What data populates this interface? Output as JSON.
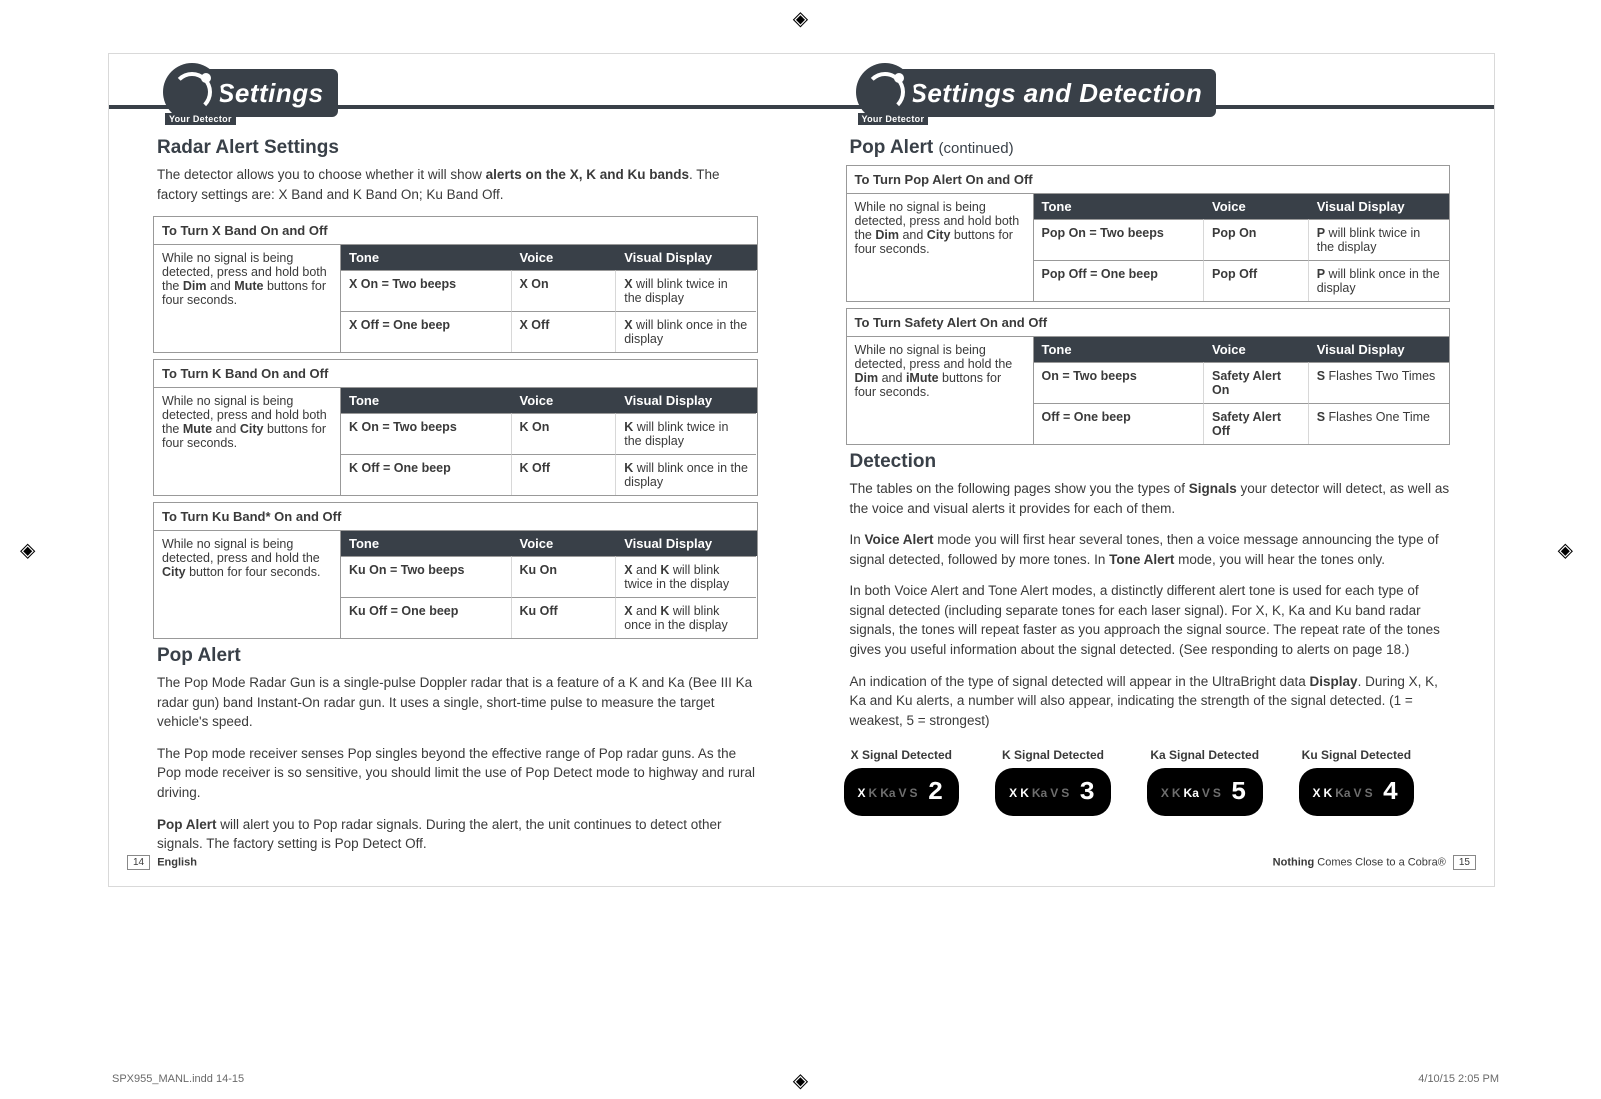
{
  "crop_glyph": "◈",
  "left_page": {
    "banner": {
      "your_detector": "Your Detector",
      "title": "Settings"
    },
    "radar_alert": {
      "heading": "Radar Alert Settings",
      "intro_before_bold": "The detector allows you to choose whether it will show ",
      "intro_bold_part": "alerts on the X, K and Ku bands",
      "intro_after_bold": ". The factory settings are: X Band and K Band On; Ku Band Off.",
      "tables": [
        {
          "caption": "To Turn X Band On and Off",
          "instruction_parts": [
            "While no signal is being detected, press and hold both the ",
            "Dim",
            " and ",
            "Mute",
            " buttons for four seconds."
          ],
          "head": {
            "tone": "Tone",
            "voice": "Voice",
            "display": "Visual Display"
          },
          "rows": [
            {
              "tone": "X On = Two beeps",
              "voice": "X On",
              "display_bold": "X",
              "display_rest": " will blink twice in the display"
            },
            {
              "tone": "X Off = One beep",
              "voice": "X Off",
              "display_bold": "X",
              "display_rest": " will blink once in the display"
            }
          ]
        },
        {
          "caption": "To Turn K Band On and Off",
          "instruction_parts": [
            "While no signal is being detected, press and hold both the ",
            "Mute",
            " and ",
            "City",
            " buttons for four seconds."
          ],
          "head": {
            "tone": "Tone",
            "voice": "Voice",
            "display": "Visual Display"
          },
          "rows": [
            {
              "tone": "K On = Two beeps",
              "voice": "K On",
              "display_bold": "K",
              "display_rest": " will blink twice in the display"
            },
            {
              "tone": "K Off = One beep",
              "voice": "K Off",
              "display_bold": "K",
              "display_rest": " will blink once in the display"
            }
          ]
        },
        {
          "caption": "To Turn Ku Band* On and Off",
          "instruction_parts": [
            "While no signal is being detected, press and hold the ",
            "City",
            " button for four seconds."
          ],
          "head": {
            "tone": "Tone",
            "voice": "Voice",
            "display": "Visual Display"
          },
          "rows": [
            {
              "tone": "Ku On = Two beeps",
              "voice": "Ku On",
              "display_bold": "X",
              "display_and": " and ",
              "display_bold2": "K",
              "display_rest": " will blink twice in the display"
            },
            {
              "tone": "Ku Off = One beep",
              "voice": "Ku Off",
              "display_bold": "X",
              "display_and": " and ",
              "display_bold2": "K",
              "display_rest": " will blink once in the display"
            }
          ]
        }
      ]
    },
    "pop_alert": {
      "heading": "Pop Alert",
      "p1": "The Pop Mode Radar Gun is a single-pulse Doppler radar that is a feature of a K and Ka (Bee III Ka radar gun) band Instant-On radar gun. It uses a single, short-time pulse to measure the target vehicle's speed.",
      "p2": "The Pop mode receiver senses Pop singles beyond the effective range of Pop radar guns. As the Pop mode receiver is so sensitive, you should limit the use of Pop Detect mode to highway and rural driving.",
      "p3_before_bold": "",
      "p3_bold": "Pop Alert",
      "p3_after_bold": " will alert you to Pop radar signals. During the alert, the unit continues to detect other signals. The factory setting is Pop Detect Off."
    },
    "footer": {
      "page_num": "14",
      "label": "English"
    }
  },
  "right_page": {
    "banner": {
      "your_detector": "Your Detector",
      "title": "Settings and Detection"
    },
    "pop_cont": {
      "heading": "Pop Alert",
      "heading_sub": "(continued)",
      "table": {
        "caption": "To Turn Pop Alert On and Off",
        "instruction_parts": [
          "While no signal is being detected, press and hold both the ",
          "Dim",
          " and ",
          "City",
          " buttons for four seconds."
        ],
        "head": {
          "tone": "Tone",
          "voice": "Voice",
          "display": "Visual Display"
        },
        "rows": [
          {
            "tone": "Pop On = Two beeps",
            "voice": "Pop On",
            "display_bold": "P",
            "display_rest": " will blink twice in the display"
          },
          {
            "tone": "Pop Off = One beep",
            "voice": "Pop Off",
            "display_bold": "P",
            "display_rest": " will blink once in the display"
          }
        ]
      },
      "safety_table": {
        "caption": "To Turn Safety Alert On and Off",
        "instruction_parts": [
          "While no signal is being detected, press and hold the ",
          "Dim",
          " and ",
          "iMute",
          " buttons for four seconds."
        ],
        "head": {
          "tone": "Tone",
          "voice": "Voice",
          "display": "Visual Display"
        },
        "rows": [
          {
            "tone": "On = Two beeps",
            "voice": "Safety Alert On",
            "display_bold": "S",
            "display_rest": " Flashes Two Times"
          },
          {
            "tone": "Off = One beep",
            "voice": "Safety Alert Off",
            "display_bold": "S",
            "display_rest": " Flashes One Time"
          }
        ]
      }
    },
    "detection": {
      "heading": "Detection",
      "p1_before": "The tables on the following pages show you the types of ",
      "p1_bold": "Signals",
      "p1_after": " your detector will detect, as well as the voice and visual alerts it provides for each of them.",
      "p2": "In Voice Alert mode you will first hear several tones, then a voice message announcing the type of signal detected, followed by more tones. In Tone Alert mode, you will hear the tones only.",
      "p2_bold1": "Voice Alert",
      "p2_bold2": "Tone Alert",
      "p3": "In both Voice Alert and Tone Alert modes, a distinctly different alert tone is used for each type of signal detected (including separate tones for each laser signal). For X, K, Ka and Ku band radar signals, the tones will repeat faster as you approach the signal source. The repeat rate of the tones gives you useful information about the signal detected. (See responding to alerts on page 18.)",
      "p4_before": "An indication of the type of signal detected will appear in the UltraBright data ",
      "p4_bold": "Display",
      "p4_after": ". During X, K, Ka and Ku alerts, a number will also appear, indicating the strength of the signal detected. (1 = weakest, 5 = strongest)",
      "signals": [
        {
          "label": "X Signal Detected",
          "active": "X",
          "num": "2"
        },
        {
          "label": "K Signal Detected",
          "active": "K",
          "num": "3"
        },
        {
          "label": "Ka Signal Detected",
          "active": "Ka",
          "num": "5"
        },
        {
          "label": "Ku Signal Detected",
          "active": "Ku",
          "num": "4"
        }
      ],
      "bands": [
        "X",
        "K",
        "Ka",
        "V",
        "S"
      ]
    },
    "footer": {
      "tagline_before": "Nothing",
      "tagline_after": " Comes Close to a Cobra®",
      "page_num": "15"
    }
  },
  "imprint": {
    "file": "SPX955_MANL.indd   14-15",
    "date": "4/10/15   2:05 PM"
  }
}
